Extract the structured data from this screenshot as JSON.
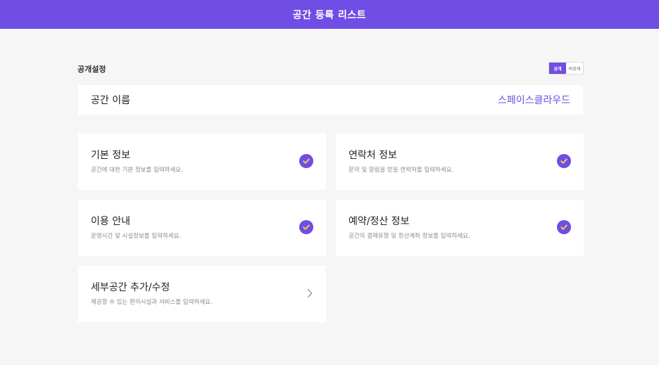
{
  "header": {
    "title": "공간 등록 리스트"
  },
  "visibility": {
    "label": "공개설정",
    "options": [
      "공개",
      "비공개"
    ],
    "selected": "공개"
  },
  "space_name": {
    "label": "공간 이름",
    "value": "스페이스클라우드"
  },
  "cards": [
    {
      "title": "기본 정보",
      "description": "공간에 대한 기본 정보를 입력하세요.",
      "status": "completed"
    },
    {
      "title": "연락처 정보",
      "description": "문의 및 알림을 받을 연락처를 입력하세요.",
      "status": "completed"
    },
    {
      "title": "이용 안내",
      "description": "운영시간 및 시설정보를 입력하세요.",
      "status": "completed"
    },
    {
      "title": "예약/정산 정보",
      "description": "공간의 결제유형 및 정산계좌 정보를 입력하세요.",
      "status": "completed"
    },
    {
      "title": "세부공간 추가/수정",
      "description": "제공할 수 있는 편의시설과 서비스를 입력하세요.",
      "status": "navigate"
    }
  ],
  "colors": {
    "accent": "#704de4",
    "background": "#f6f6f6",
    "card": "#ffffff",
    "check_mark": "#f5c84b"
  },
  "icons": {
    "completed": "check-circle-icon",
    "navigate": "chevron-right-icon"
  }
}
